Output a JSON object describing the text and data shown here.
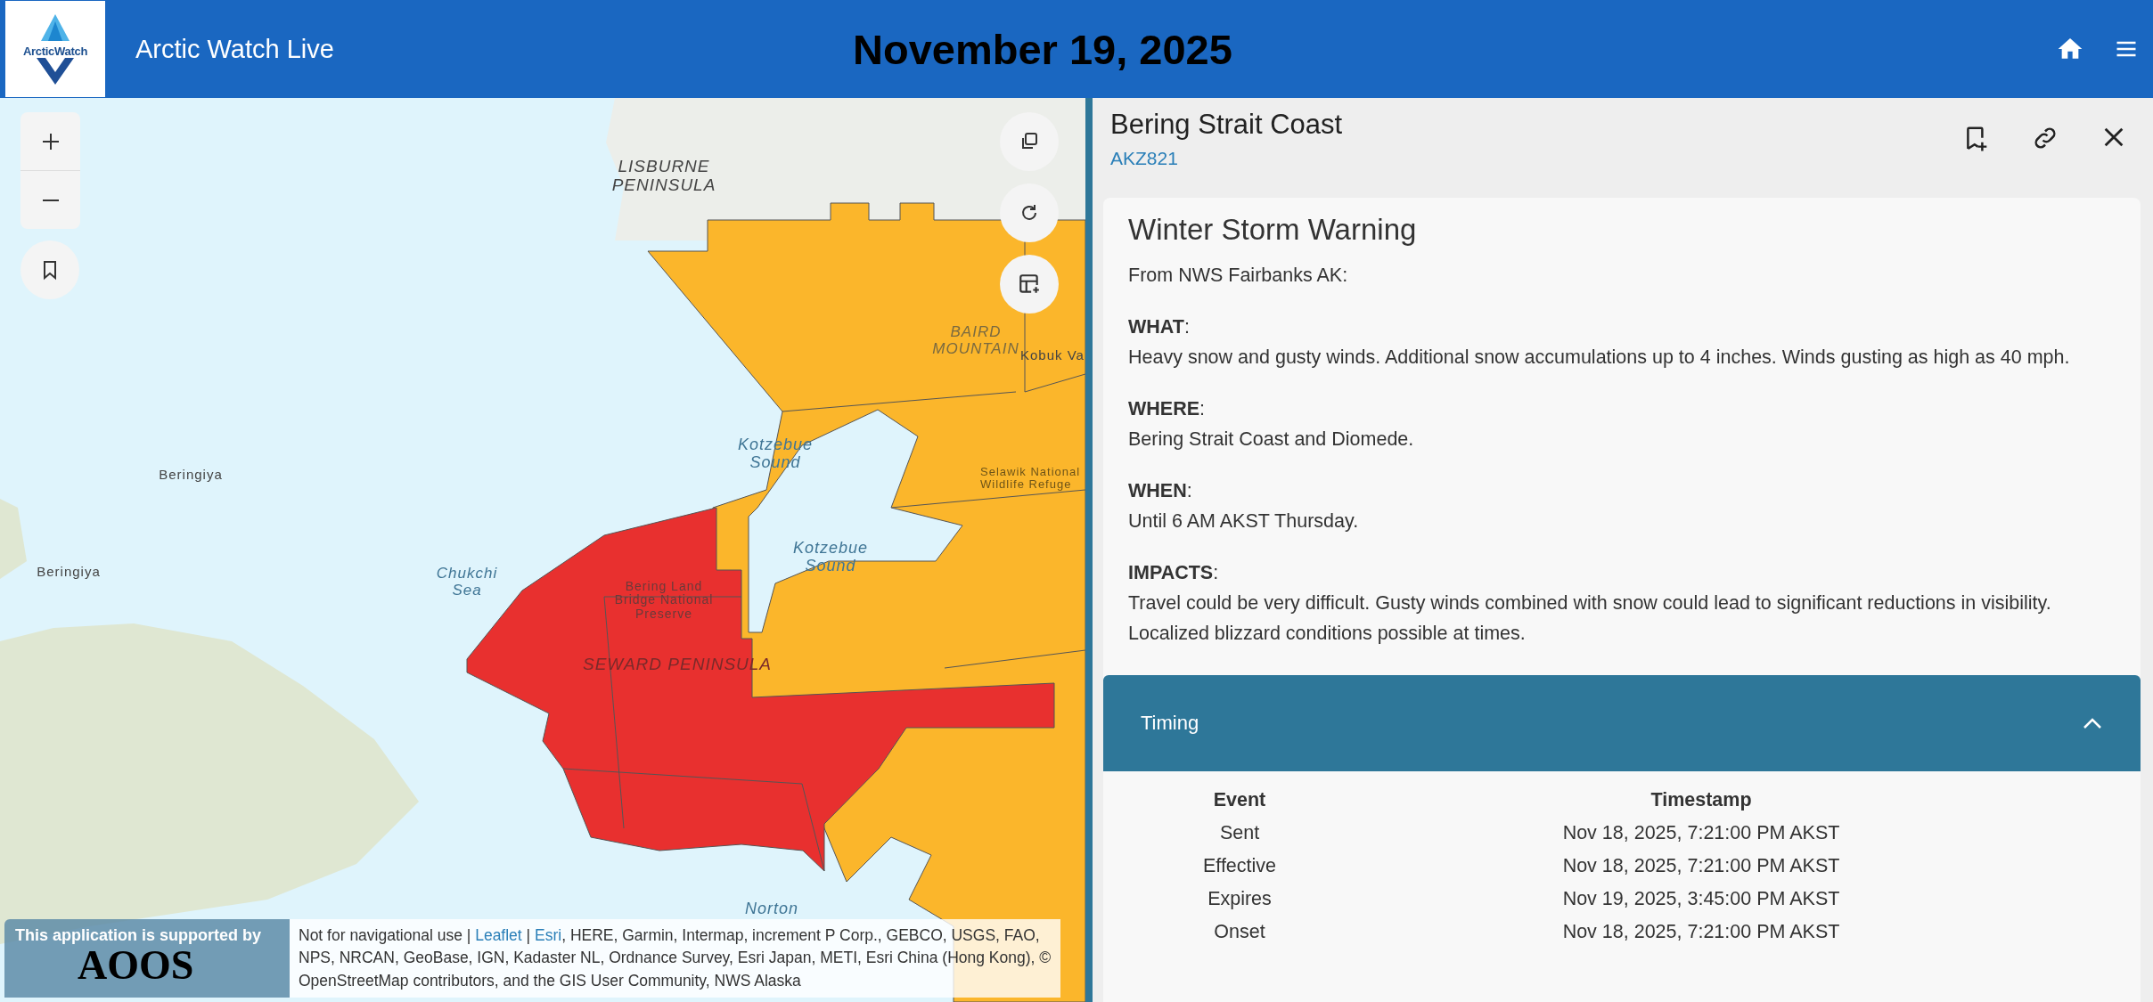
{
  "header": {
    "logo_text": "ArcticWatch",
    "app_title": "Arctic Watch Live",
    "date": "November 19, 2025"
  },
  "map": {
    "labels": [
      "LISBURNE PENINSULA",
      "BAIRD MOUNTAIN",
      "Kobuk Va",
      "Kotzebue Sound",
      "Beringiya",
      "Selawik National Wildlife Refuge",
      "Kotzebue Sound",
      "Beringiya",
      "Chukchi Sea",
      "Bering Land Bridge National Preserve",
      "SEWARD PENINSULA",
      "Norton"
    ],
    "alert_zones": [
      {
        "color": "#fbb62b"
      },
      {
        "color": "#e8302f"
      }
    ],
    "support_badge": {
      "text": "This application is supported by",
      "logo": "AOOS"
    },
    "attribution": [
      {
        "kind": "text",
        "text": "Not for navigational use"
      },
      {
        "kind": "sep",
        "text": "|"
      },
      {
        "kind": "link",
        "text": "Leaflet"
      },
      {
        "kind": "sep",
        "text": "|"
      },
      {
        "kind": "link",
        "text": "Esri"
      },
      {
        "kind": "text",
        "text": ", HERE, Garmin, Intermap, increment P Corp., GEBCO, USGS, FAO, NPS, NRCAN, GeoBase, IGN, Kadaster NL, Ordnance Survey, Esri Japan, METI, Esri China (Hong Kong), © OpenStreetMap contributors, and the GIS User Community, NWS Alaska"
      }
    ]
  },
  "panel": {
    "title": "Bering Strait Coast",
    "zone_code": "AKZ821",
    "alert": {
      "title": "Winter Storm Warning",
      "source": "From NWS Fairbanks AK:",
      "sections": [
        {
          "label": "**WHAT**:",
          "text": "Heavy snow and gusty winds. Additional snow accumulations up to 4 inches. Winds gusting as high as 40 mph."
        },
        {
          "label": "**WHERE**:",
          "text": "Bering Strait Coast and Diomede."
        },
        {
          "label": "**WHEN**:",
          "text": "Until 6 AM AKST Thursday."
        },
        {
          "label": "**IMPACTS**:",
          "text": "Travel could be very difficult. Gusty winds combined with snow could lead to significant reductions in visibility. Localized blizzard conditions possible at times."
        }
      ]
    },
    "timing": {
      "title": "Timing",
      "expanded": true,
      "columns": [
        "Event",
        "Timestamp"
      ],
      "rows": [
        [
          "Sent",
          "Nov 18, 2025, 7:21:00 PM AKST"
        ],
        [
          "Effective",
          "Nov 18, 2025, 7:21:00 PM AKST"
        ],
        [
          "Expires",
          "Nov 19, 2025, 3:45:00 PM AKST"
        ],
        [
          "Onset",
          "Nov 18, 2025, 7:21:00 PM AKST"
        ]
      ]
    }
  }
}
